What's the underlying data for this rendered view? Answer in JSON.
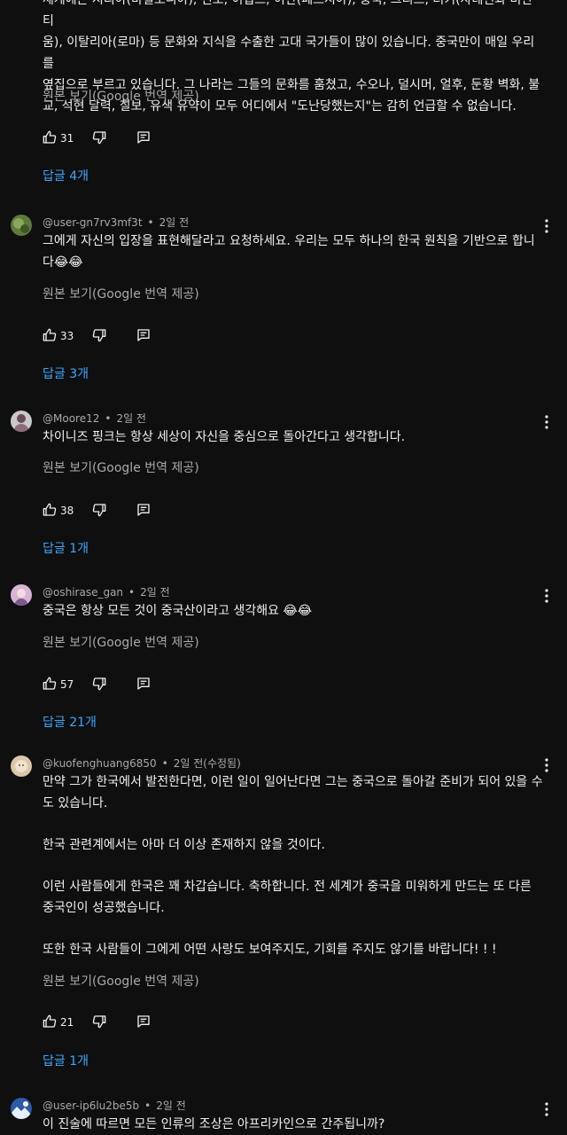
{
  "colors": {
    "background": "#0f0f0f",
    "text": "#f1f1f1",
    "secondary_text": "#aaaaaa",
    "link": "#3ea6ff"
  },
  "partial_comment": {
    "lines": [
      "세계에는 시리아(바빌로니아), 인도, 이집트, 이란(페르시아), 중국, 그리스, 터키(사테인과 비잔티",
      "움), 이탈리아(로마) 등 문화와 지식을 수출한 고대 국가들이 많이 있습니다. 중국만이 매일 우리를",
      "옆집으로 부르고 있습니다. 그 나라는 그들의 문화를 훔쳤고, 수오나, 덜시머, 얼후, 둔황 벽화, 불",
      "교, 석현 달력, 칠보, 유색 유약이 모두 어디에서 \"도난당했는지\"는 감히 언급할 수 없습니다."
    ],
    "translate_link": "원본 보기(Google 번역 제공)",
    "likes": "31",
    "replies_label": "답글 4개"
  },
  "comments": [
    {
      "username": "@user-gn7rv3mf3t",
      "dot": "•",
      "time": "2일 전",
      "paragraphs": [
        "그에게 자신의 입장을 표현해달라고 요청하세요. 우리는 모두 하나의 한국 원칙을 기반으로 합니",
        "다😂😂"
      ],
      "translate_link": "원본 보기(Google 번역 제공)",
      "likes": "33",
      "replies_label": "답글 3개"
    },
    {
      "username": "@Moore12",
      "dot": "•",
      "time": "2일 전",
      "paragraphs": [
        "차이니즈 핑크는 항상 세상이 자신을 중심으로 돌아간다고 생각합니다."
      ],
      "translate_link": "원본 보기(Google 번역 제공)",
      "likes": "38",
      "replies_label": "답글 1개"
    },
    {
      "username": "@oshirase_gan",
      "dot": "•",
      "time": "2일 전",
      "paragraphs": [
        "중국은 항상 모든 것이 중국산이라고 생각해요 😂😂"
      ],
      "translate_link": "원본 보기(Google 번역 제공)",
      "likes": "57",
      "replies_label": "답글 21개"
    },
    {
      "username": "@kuofenghuang6850",
      "dot": "•",
      "time": "2일 전(수정됨)",
      "paragraphs": [
        "만약 그가 한국에서 발전한다면, 이런 일이 일어난다면 그는 중국으로 돌아갈 준비가 되어 있을 수",
        "도 있습니다.",
        "한국 관련계에서는 아마 더 이상 존재하지 않을 것이다.",
        "이런 사람들에게 한국은 꽤 차갑습니다. 축하합니다. 전 세계가 중국을 미워하게 만드는 또 다른",
        "중국인이 성공했습니다.",
        "또한 한국 사람들이 그에게 어떤 사랑도 보여주지도, 기회를 주지도 않기를 바랍니다! ! !"
      ],
      "translate_link": "원본 보기(Google 번역 제공)",
      "likes": "21",
      "replies_label": "답글 1개"
    },
    {
      "username": "@user-ip6lu2be5b",
      "dot": "•",
      "time": "2일 전",
      "paragraphs": [
        "이 진술에 따르면 모든 인류의 조상은 아프리카인으로 간주됩니까?"
      ]
    }
  ],
  "icons": {
    "like": "thumb-up-icon",
    "dislike": "thumb-down-icon",
    "reply": "reply-icon",
    "more": "more-vertical-icon"
  }
}
